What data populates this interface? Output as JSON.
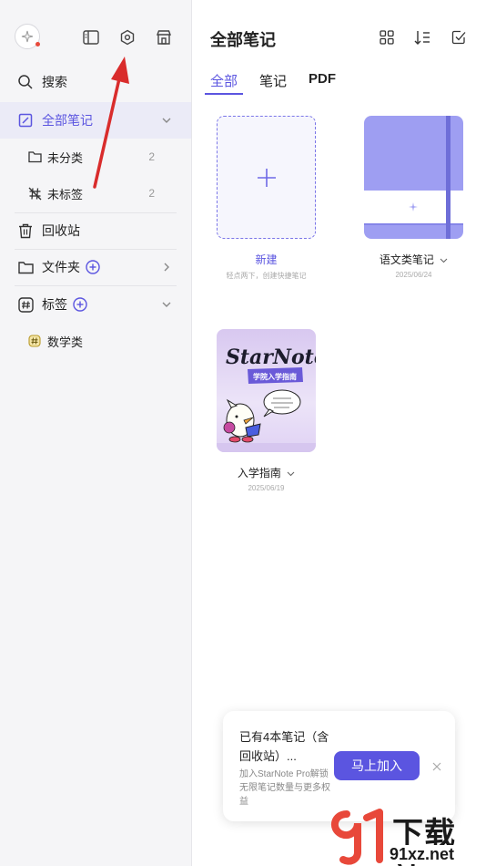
{
  "sidebar": {
    "search_label": "搜索",
    "all_notes_label": "全部笔记",
    "uncategorized_label": "未分类",
    "uncategorized_count": "2",
    "untagged_label": "未标签",
    "untagged_count": "2",
    "trash_label": "回收站",
    "folders_label": "文件夹",
    "tags_label": "标签",
    "tag_items": [
      "数学类"
    ]
  },
  "main": {
    "title": "全部笔记",
    "tabs": [
      "全部",
      "笔记",
      "PDF"
    ],
    "new_card": {
      "title": "新建",
      "hint": "轻点两下，创建快捷笔记"
    },
    "notebooks": [
      {
        "title": "语文类笔记",
        "date": "2025/06/24"
      },
      {
        "title": "入学指南",
        "date": "2025/06/19",
        "cover_text": "StarNote",
        "cover_subtitle": "学院入学指南"
      }
    ]
  },
  "promo": {
    "title": "已有4本笔记（含回收站）...",
    "desc": "加入StarNote Pro解锁无限笔记数量与更多权益",
    "button": "马上加入"
  },
  "watermark": {
    "big": "下载站",
    "small": "91xz.net"
  },
  "colors": {
    "accent": "#5b55e0",
    "annotation_arrow": "#d92c2c"
  }
}
